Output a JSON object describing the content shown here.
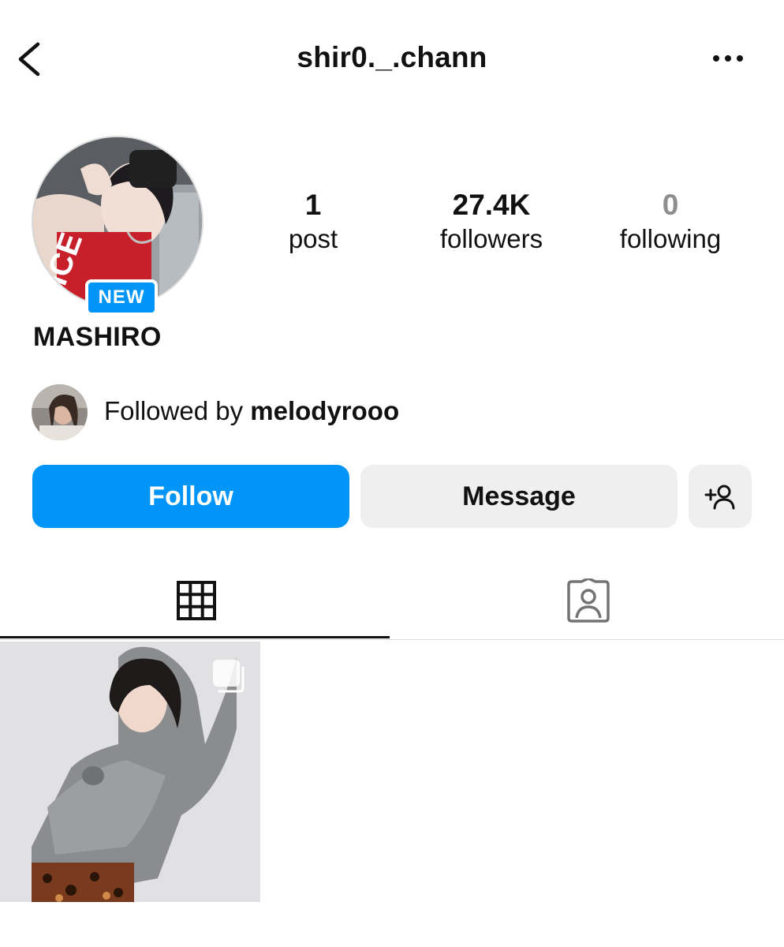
{
  "header": {
    "username": "shir0._.chann",
    "back_icon": "chevron-left-icon",
    "more_icon": "more-horizontal-icon"
  },
  "profile": {
    "badge": "NEW",
    "display_name": "MASHIRO",
    "stats": [
      {
        "value": "1",
        "label": "post"
      },
      {
        "value": "27.4K",
        "label": "followers"
      },
      {
        "value": "0",
        "label": "following"
      }
    ]
  },
  "followed_by": {
    "prefix": "Followed by ",
    "username": "melodyrooo"
  },
  "actions": {
    "follow_label": "Follow",
    "message_label": "Message",
    "add_icon": "add-person-icon"
  },
  "tabs": [
    {
      "icon": "grid-icon",
      "active": true
    },
    {
      "icon": "tagged-person-icon",
      "active": false
    }
  ],
  "posts": [
    {
      "type": "carousel",
      "icon": "multiple-images-icon"
    }
  ],
  "colors": {
    "accent": "#0095f6",
    "button_gray": "#efefef",
    "muted": "#8e8e8e",
    "divider": "#dbdbdb"
  }
}
